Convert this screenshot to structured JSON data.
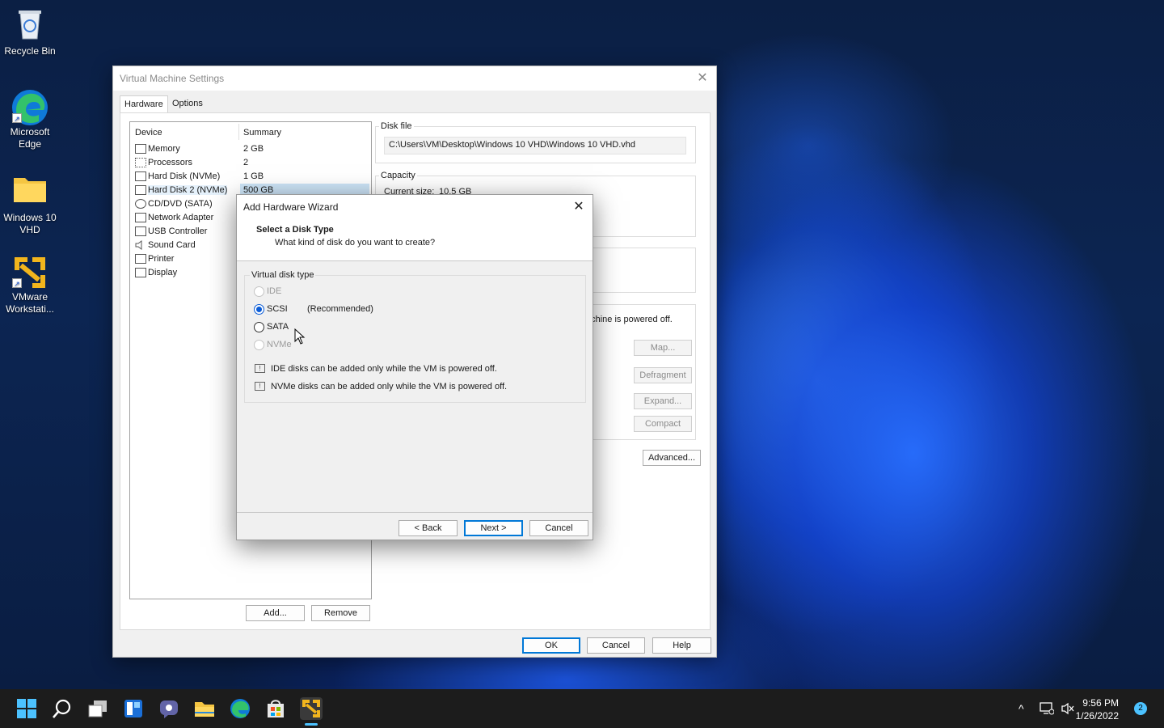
{
  "desktop": {
    "icons": [
      {
        "label": "Recycle Bin"
      },
      {
        "label": "Microsoft Edge"
      },
      {
        "label": "Windows 10 VHD"
      },
      {
        "label": "VMware Workstati..."
      }
    ],
    "shortcut_glyph": "↗"
  },
  "vm_settings": {
    "title": "Virtual Machine Settings",
    "close_glyph": "✕",
    "tabs": [
      "Hardware",
      "Options"
    ],
    "list_headers": {
      "device": "Device",
      "summary": "Summary"
    },
    "devices": [
      {
        "name": "Memory",
        "summary": "2 GB",
        "icon": "memory-icon"
      },
      {
        "name": "Processors",
        "summary": "2",
        "icon": "processor-icon"
      },
      {
        "name": "Hard Disk (NVMe)",
        "summary": "1 GB",
        "icon": "hard-disk-icon"
      },
      {
        "name": "Hard Disk 2 (NVMe)",
        "summary": "500 GB",
        "icon": "hard-disk-icon",
        "selected": true
      },
      {
        "name": "CD/DVD (SATA)",
        "summary": "",
        "icon": "cd-dvd-icon"
      },
      {
        "name": "Network Adapter",
        "summary": "",
        "icon": "network-icon"
      },
      {
        "name": "USB Controller",
        "summary": "",
        "icon": "usb-icon"
      },
      {
        "name": "Sound Card",
        "summary": "",
        "icon": "sound-icon"
      },
      {
        "name": "Printer",
        "summary": "",
        "icon": "printer-icon"
      },
      {
        "name": "Display",
        "summary": "",
        "icon": "display-icon"
      }
    ],
    "add_button": "Add...",
    "remove_button": "Remove",
    "disk_file_label": "Disk file",
    "disk_file_value": "C:\\Users\\VM\\Desktop\\Windows 10 VHD\\Windows 10 VHD.vhd",
    "capacity_label": "Capacity",
    "current_size_label": "Current size:",
    "current_size_value": "10.5 GB",
    "powered_off_note": "achine is powered off.",
    "map_button": "Map...",
    "defragment_button": "Defragment",
    "expand_button": "Expand...",
    "compact_button": "Compact",
    "advanced_button": "Advanced...",
    "ok_button": "OK",
    "cancel_button": "Cancel",
    "help_button": "Help"
  },
  "wizard": {
    "title": "Add Hardware Wizard",
    "close_glyph": "✕",
    "heading": "Select a Disk Type",
    "subheading": "What kind of disk do you want to create?",
    "group_label": "Virtual disk type",
    "options": [
      {
        "label": "IDE",
        "enabled": false,
        "checked": false
      },
      {
        "label": "SCSI",
        "enabled": true,
        "checked": true,
        "note": "(Recommended)"
      },
      {
        "label": "SATA",
        "enabled": true,
        "checked": false
      },
      {
        "label": "NVMe",
        "enabled": false,
        "checked": false
      }
    ],
    "info": [
      "IDE disks can be added only while the VM is powered off.",
      "NVMe disks can be added only while the VM is powered off."
    ],
    "back_button": "< Back",
    "next_button": "Next >",
    "cancel_button": "Cancel"
  },
  "taskbar": {
    "apps": [
      "start-icon",
      "search-icon",
      "task-view-icon",
      "widgets-icon",
      "teams-chat-icon",
      "file-explorer-icon",
      "edge-icon",
      "store-icon",
      "vmware-icon"
    ],
    "chevron_glyph": "^",
    "time": "9:56 PM",
    "date": "1/26/2022",
    "notification_count": "2"
  }
}
